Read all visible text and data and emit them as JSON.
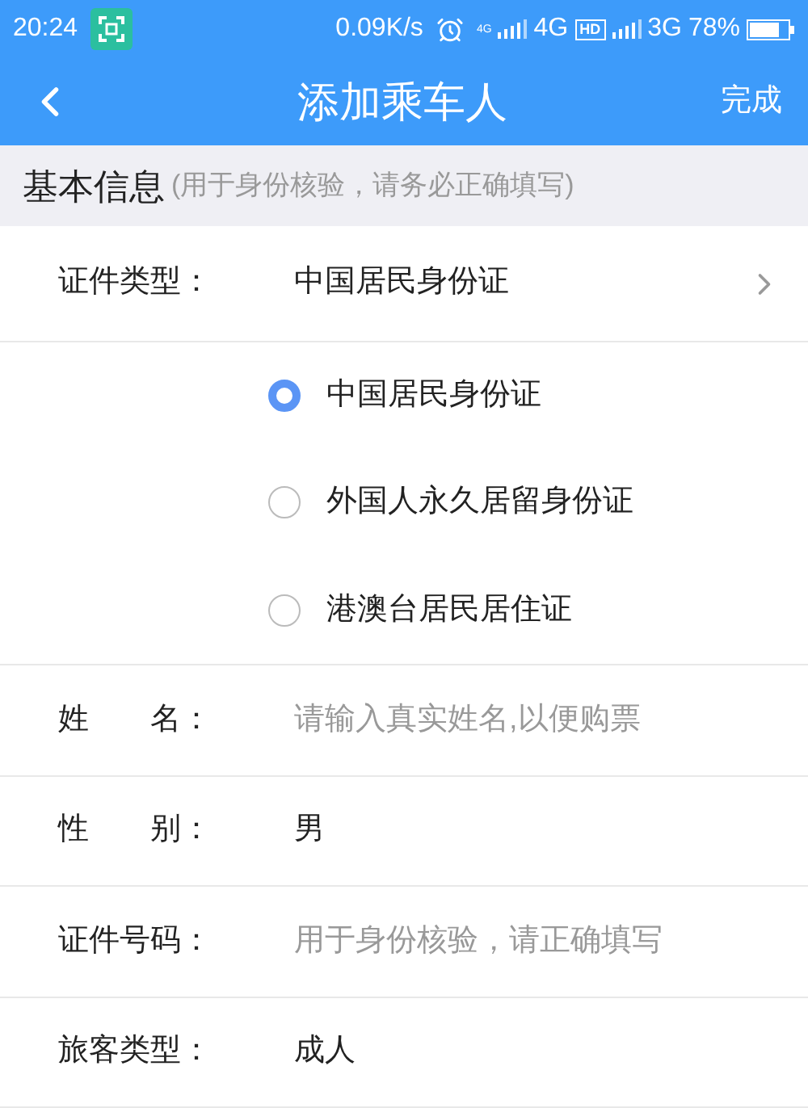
{
  "status_bar": {
    "time": "20:24",
    "speed": "0.09K/s",
    "sim1_small": "4G",
    "sim1": "4G",
    "hd": "HD",
    "sim2": "3G",
    "battery": "78%"
  },
  "nav": {
    "title": "添加乘车人",
    "action": "完成"
  },
  "section": {
    "title": "基本信息",
    "note": "(用于身份核验，请务必正确填写)"
  },
  "id_type": {
    "label": "证件类型：",
    "value": "中国居民身份证",
    "expanded": true,
    "options": [
      {
        "label": "中国居民身份证",
        "selected": true
      },
      {
        "label": "外国人永久居留身份证",
        "selected": false
      },
      {
        "label": "港澳台居民居住证",
        "selected": false
      }
    ]
  },
  "fields": [
    {
      "kind": "input",
      "label": "姓　　名：",
      "placeholder": "请输入真实姓名,以便购票"
    },
    {
      "kind": "value",
      "label": "性　　别：",
      "value": "男"
    },
    {
      "kind": "input",
      "label": "证件号码：",
      "placeholder": "用于身份核验，请正确填写"
    },
    {
      "kind": "value",
      "label": "旅客类型：",
      "value": "成人"
    }
  ]
}
